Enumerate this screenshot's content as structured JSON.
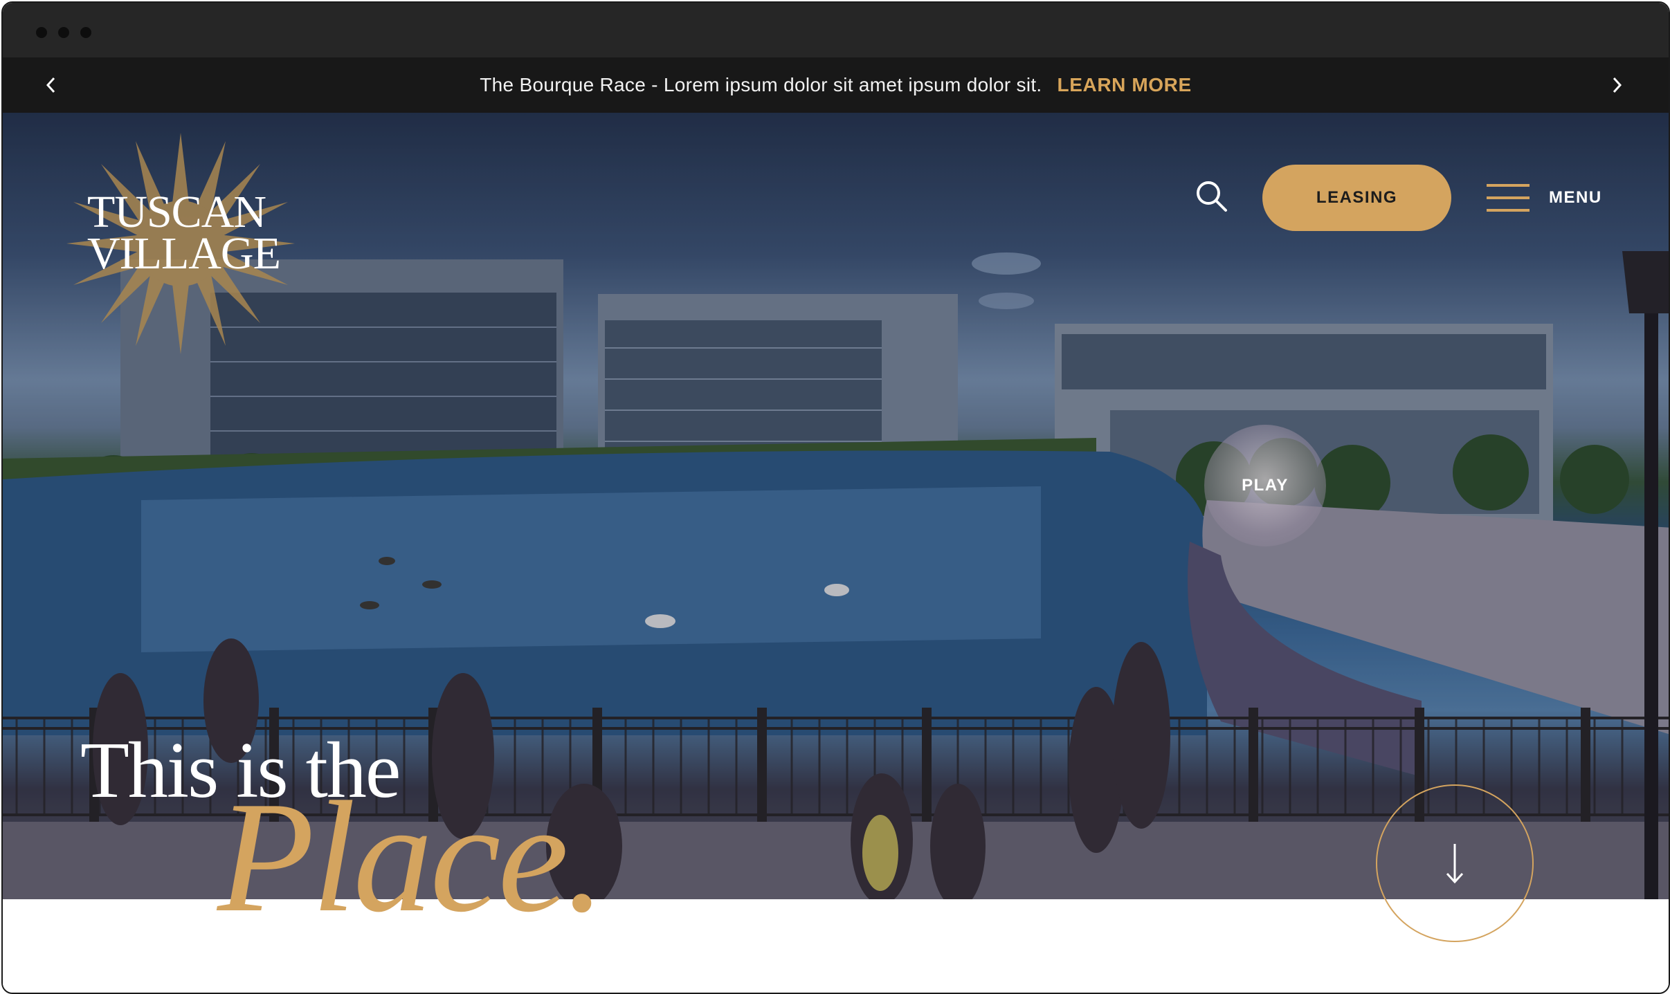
{
  "announcement": {
    "text": "The Bourque Race - Lorem ipsum dolor sit amet ipsum dolor sit.",
    "link": "LEARN MORE",
    "prev_icon": "chevron-left-icon",
    "next_icon": "chevron-right-icon"
  },
  "header": {
    "logo_line1": "TUSCAN",
    "logo_line2": "VILLAGE",
    "search_icon": "search-icon",
    "leasing_label": "LEASING",
    "menu_label": "MENU",
    "menu_icon": "hamburger-icon"
  },
  "hero": {
    "play_label": "PLAY",
    "headline": "This is the",
    "script_word": "Place.",
    "scroll_icon": "arrow-down-icon"
  },
  "colors": {
    "accent": "#d4a45f",
    "bar": "#181818",
    "chrome": "#262626"
  }
}
